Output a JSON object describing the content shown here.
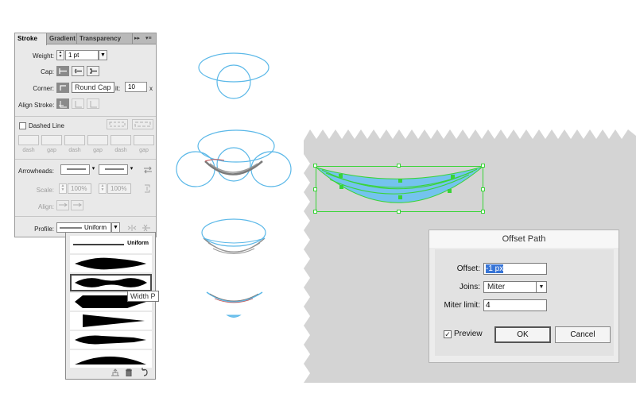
{
  "stroke_panel": {
    "tabs": [
      "Stroke",
      "Gradient",
      "Transparency"
    ],
    "collapse_glyph": "▸▸",
    "menu_glyph": "▾≡",
    "weight_label": "Weight:",
    "weight_value": "1 pt",
    "cap_label": "Cap:",
    "corner_label": "Corner:",
    "corner_tooltip": "Round Cap",
    "limit_suffix": "it:",
    "limit_value": "10",
    "limit_unit": "x",
    "align_label": "Align Stroke:",
    "dashed_label": "Dashed Line",
    "dashed_checked": false,
    "dash_gap_labels": [
      "dash",
      "gap",
      "dash",
      "gap",
      "dash",
      "gap"
    ],
    "arrowheads_label": "Arrowheads:",
    "scale_label": "Scale:",
    "scale_start": "100%",
    "scale_end": "100%",
    "align_arrows_label": "Align:",
    "profile_label": "Profile:",
    "profile_value": "Uniform"
  },
  "profile_dropdown": {
    "options": [
      "Uniform",
      "",
      "",
      "",
      "",
      "",
      ""
    ],
    "selected_index": 2,
    "hover_tooltip": "Width P",
    "footer_icons": [
      "add-profile-icon",
      "trash-icon",
      "reset-icon"
    ]
  },
  "offset_dialog": {
    "title": "Offset Path",
    "offset_label": "Offset:",
    "offset_value": "-1 px",
    "joins_label": "Joins:",
    "joins_value": "Miter",
    "miter_label": "Miter limit:",
    "miter_value": "4",
    "preview_label": "Preview",
    "preview_checked": true,
    "preview_mark": "✓",
    "ok_label": "OK",
    "cancel_label": "Cancel"
  },
  "colors": {
    "guide_stroke": "#5bb8e8",
    "selection": "#39d437",
    "fill_blue": "#74c3ee",
    "canvas_gray": "#d4d4d4"
  }
}
